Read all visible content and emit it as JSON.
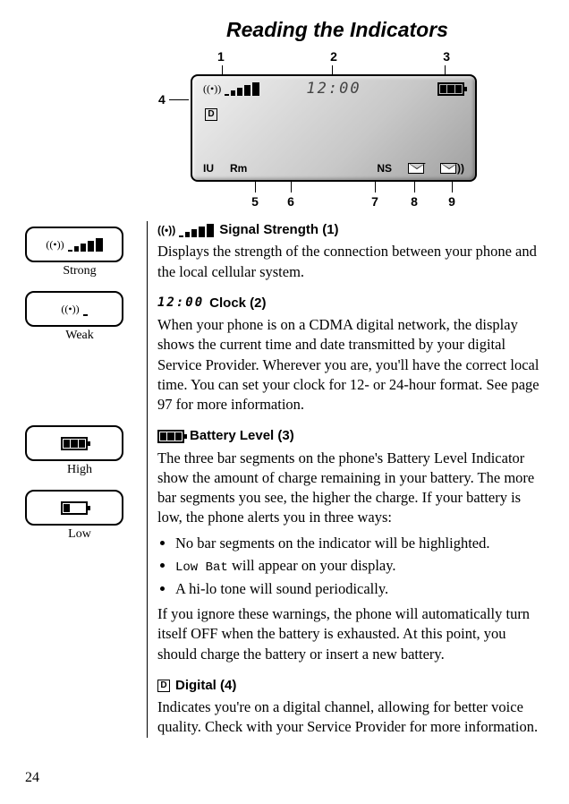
{
  "title": "Reading the Indicators",
  "page_number": "24",
  "callouts": {
    "top": [
      "1",
      "2",
      "3"
    ],
    "left": "4",
    "bottom": [
      "5",
      "6",
      "7",
      "8",
      "9"
    ]
  },
  "screen": {
    "clock": "12:00",
    "d_label": "D",
    "bottom_labels": {
      "iu": "IU",
      "rm": "Rm",
      "ns": "NS"
    }
  },
  "left_examples": {
    "signal_strong": "Strong",
    "signal_weak": "Weak",
    "battery_high": "High",
    "battery_low": "Low"
  },
  "sections": {
    "signal": {
      "heading": "Signal Strength (1)",
      "body": "Displays the strength of the connection between your phone and the local cellular system."
    },
    "clock": {
      "icon_text": "12:00",
      "heading": "Clock (2)",
      "body": "When your phone is on a CDMA digital network, the display shows the current time and date transmitted by your digital Service Provider. Wherever you are, you'll have the correct local time. You can set your clock for 12- or 24-hour format. See page 97 for more information."
    },
    "battery": {
      "heading": "Battery Level (3)",
      "body": "The three bar segments on the phone's Battery Level Indicator show the amount of charge remaining in your battery. The more bar segments you see, the higher the charge. If your battery is low, the phone alerts you in three ways:",
      "bullets_pre": "No bar segments on the indicator will be highlighted.",
      "bullets_code": "Low Bat",
      "bullets_code_suffix": " will appear on your display.",
      "bullets_tone": "A hi-lo tone will sound periodically.",
      "after": "If you ignore these warnings, the phone will automatically turn itself OFF when the battery is exhausted. At this point, you should charge the battery or insert a new battery."
    },
    "digital": {
      "icon_label": "D",
      "heading": "Digital (4)",
      "body": "Indicates you're on a digital channel, allowing for better voice quality. Check with your Service Provider for more information."
    }
  }
}
